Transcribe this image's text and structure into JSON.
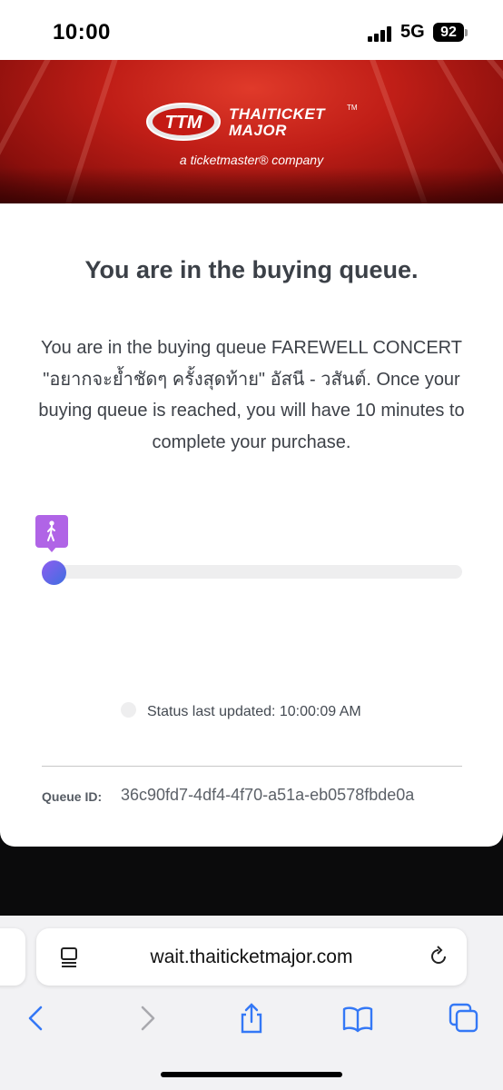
{
  "status_bar": {
    "time": "10:00",
    "network": "5G",
    "battery": "92"
  },
  "banner": {
    "logo_letters": "TTM",
    "brand_line1": "THAITICKET",
    "brand_line2": "MAJOR",
    "trademark": "TM",
    "tagline": "a ticketmaster® company"
  },
  "queue": {
    "heading": "You are in the buying queue.",
    "message": "You are in the buying queue FAREWELL CONCERT \"อยากจะย้ำชัดๆ ครั้งสุดท้าย\" อัสนี - วสันต์. Once your buying queue is reached, you will have 10 minutes to complete your purchase.",
    "progress_fraction": 0.0,
    "status_updated": "Status last updated: 10:00:09 AM",
    "queue_id_label": "Queue ID:",
    "queue_id": "36c90fd7-4df4-4f70-a51a-eb0578fbde0a"
  },
  "browser": {
    "url": "wait.thaiticketmajor.com"
  },
  "colors": {
    "banner_red": "#c01e17",
    "walker_purple": "#b064e6",
    "progress_gradient_start": "#8e5cf0",
    "progress_gradient_end": "#3e6fe0",
    "safari_blue": "#3478f6"
  },
  "icons": {
    "page_settings": "page-menu-icon",
    "reload": "reload-icon",
    "back": "back-chevron-icon",
    "forward": "forward-chevron-icon",
    "share": "share-icon",
    "bookmarks": "book-icon",
    "tabs": "tabs-icon",
    "queue_position": "walking-person-icon"
  }
}
